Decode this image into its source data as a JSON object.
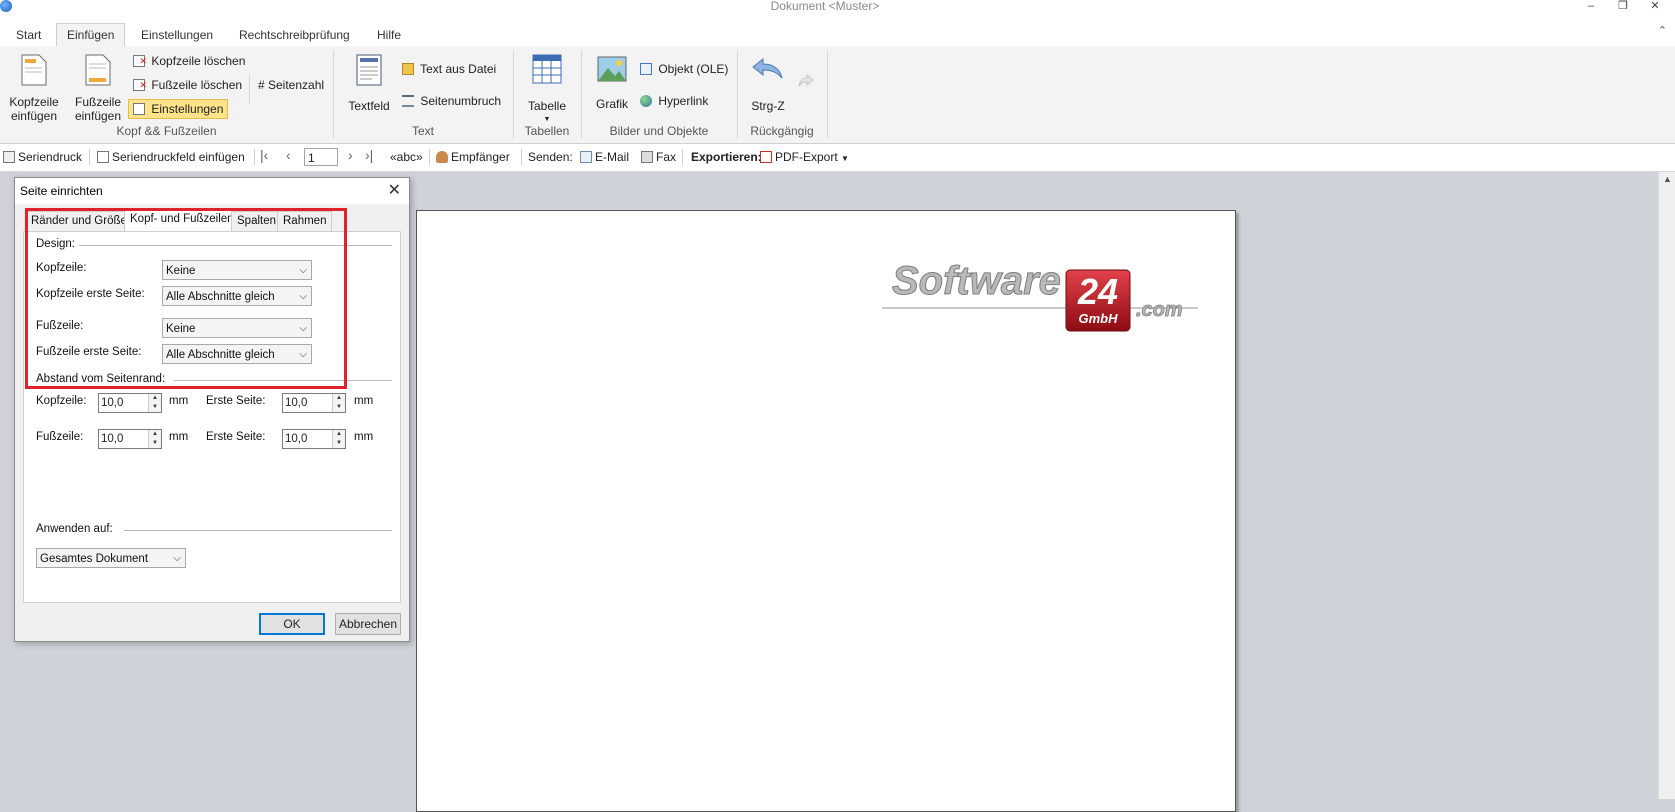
{
  "window": {
    "title": "Dokument <Muster>",
    "minimize": "–",
    "restore": "❐",
    "close": "✕"
  },
  "tabs": [
    "Start",
    "Einfügen",
    "Einstellungen",
    "Rechtschreibprüfung",
    "Hilfe"
  ],
  "active_tab": "Einfügen",
  "ribbon": {
    "kopf_group_label": "Kopf && Fußzeilen",
    "kopfzeile_einfuegen": [
      "Kopfzeile",
      "einfügen"
    ],
    "fusszeile_einfuegen": [
      "Fußzeile",
      "einfügen"
    ],
    "kopfzeile_loeschen": "Kopfzeile löschen",
    "fusszeile_loeschen": "Fußzeile löschen",
    "einstellungen": "Einstellungen",
    "seitenzahl": "# Seitenzahl",
    "text_group_label": "Text",
    "textfeld": "Textfeld",
    "text_aus_datei": "Text aus Datei",
    "seitenumbruch": "Seitenumbruch",
    "tabellen_group_label": "Tabellen",
    "tabelle": "Tabelle",
    "bilder_group_label": "Bilder und Objekte",
    "grafik": "Grafik",
    "objekt_ole": "Objekt (OLE)",
    "hyperlink": "Hyperlink",
    "rueckgaengig_group_label": "Rückgängig",
    "strg_z": "Strg-Z"
  },
  "toolbar": {
    "seriendruck": "Seriendruck",
    "seriendruckfeld": "Seriendruckfeld einfügen",
    "page_number": "1",
    "abc": "«abc»",
    "empfaenger": "Empfänger",
    "senden": "Senden:",
    "email": "E-Mail",
    "fax": "Fax",
    "exportieren": "Exportieren:",
    "pdf_export": "PDF-Export"
  },
  "logo": {
    "word": "Software",
    "number": "24",
    "suffix": "GmbH",
    "domain": ".com"
  },
  "dialog": {
    "title": "Seite einrichten",
    "tabs": [
      "Ränder und Größe",
      "Kopf- und Fußzeilen",
      "Spalten",
      "Rahmen"
    ],
    "active_tab": "Kopf- und Fußzeilen",
    "design_label": "Design:",
    "kopfzeile_label": "Kopfzeile:",
    "kopfzeile_value": "Keine",
    "kopfzeile_erste_label": "Kopfzeile erste Seite:",
    "kopfzeile_erste_value": "Alle Abschnitte gleich",
    "fusszeile_label": "Fußzeile:",
    "fusszeile_value": "Keine",
    "fusszeile_erste_label": "Fußzeile erste Seite:",
    "fusszeile_erste_value": "Alle Abschnitte gleich",
    "abstand_label": "Abstand vom Seitenrand:",
    "abstand_kopf_label": "Kopfzeile:",
    "abstand_kopf_value": "10,0",
    "abstand_kopf_erste_label": "Erste Seite:",
    "abstand_kopf_erste_value": "10,0",
    "abstand_fuss_label": "Fußzeile:",
    "abstand_fuss_value": "10,0",
    "abstand_fuss_erste_label": "Erste Seite:",
    "abstand_fuss_erste_value": "10,0",
    "unit": "mm",
    "anwenden_label": "Anwenden auf:",
    "anwenden_value": "Gesamtes Dokument",
    "ok": "OK",
    "abbrechen": "Abbrechen"
  },
  "colors": {
    "highlight_box": "#e0222a",
    "active_button": "#fde38a",
    "logo_red": "#b3121b"
  }
}
